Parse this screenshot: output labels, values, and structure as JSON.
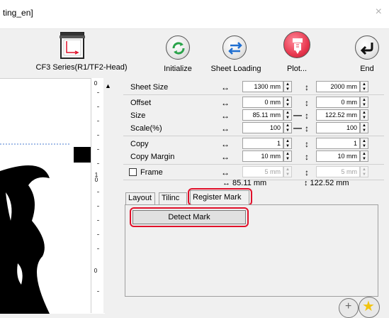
{
  "window": {
    "title": "ting_en]",
    "close_glyph": "×"
  },
  "device": {
    "name": "CF3 Series(R1/TF2-Head)"
  },
  "toolbar": {
    "initialize": "Initialize",
    "sheet_loading": "Sheet Loading",
    "plot": "Plot...",
    "end": "End"
  },
  "ruler": {
    "labels": [
      "0",
      "10",
      "0"
    ]
  },
  "settings": {
    "sheet_size": {
      "label": "Sheet Size",
      "width": "1300 mm",
      "height": "2000 mm"
    },
    "offset": {
      "label": "Offset",
      "x": "0 mm",
      "y": "0 mm"
    },
    "size": {
      "label": "Size",
      "w": "85.11 mm",
      "h": "122.52 mm"
    },
    "scale": {
      "label": "Scale(%)",
      "x": "100",
      "y": "100"
    },
    "copy": {
      "label": "Copy",
      "x": "1",
      "y": "1"
    },
    "copy_margin": {
      "label": "Copy Margin",
      "x": "10 mm",
      "y": "10 mm"
    },
    "frame": {
      "label": "Frame",
      "x": "5 mm",
      "y": "5 mm"
    },
    "summary": {
      "w": "↔ 85.11 mm",
      "h": "↕ 122.52 mm"
    },
    "arrows": {
      "h": "↔",
      "v": "↕",
      "link": "—"
    }
  },
  "tabs": {
    "layout": "Layout",
    "tiling": "Tilinc",
    "register_mark": "Register Mark"
  },
  "register_mark": {
    "detect_button": "Detect Mark"
  },
  "colors": {
    "highlight": "#e0102a",
    "plot_button": "#e8384f",
    "initialize_icon": "#2aa34a",
    "sheet_loading_icon": "#1f6fd1"
  }
}
